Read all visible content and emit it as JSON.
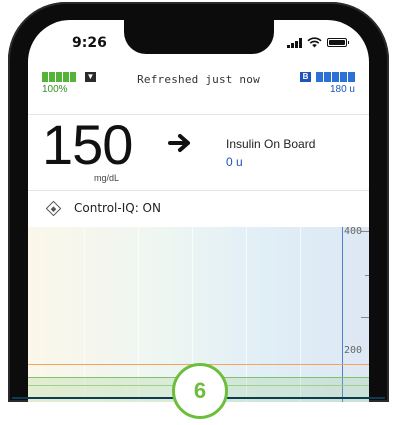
{
  "status_bar": {
    "time": "9:26"
  },
  "topbar": {
    "pump_battery_percent": "100%",
    "refresh_status": "Refreshed just now",
    "insulin_badge": "B",
    "insulin_remaining": "180 u"
  },
  "reading": {
    "bg_value": "150",
    "bg_unit": "mg/dL",
    "trend_icon": "arrow-right-icon",
    "iob_label": "Insulin On Board",
    "iob_value": "0 u"
  },
  "control_iq": {
    "status_text": "Control-IQ: ON"
  },
  "graph": {
    "axis_labels": [
      "400",
      "200"
    ]
  },
  "step": {
    "number": "6"
  },
  "colors": {
    "accent_blue": "#1b56b8",
    "battery_green": "#56b33a",
    "step_green": "#6dbe3a",
    "high_threshold": "#f2a45a",
    "target_range": "#7cc36a"
  }
}
